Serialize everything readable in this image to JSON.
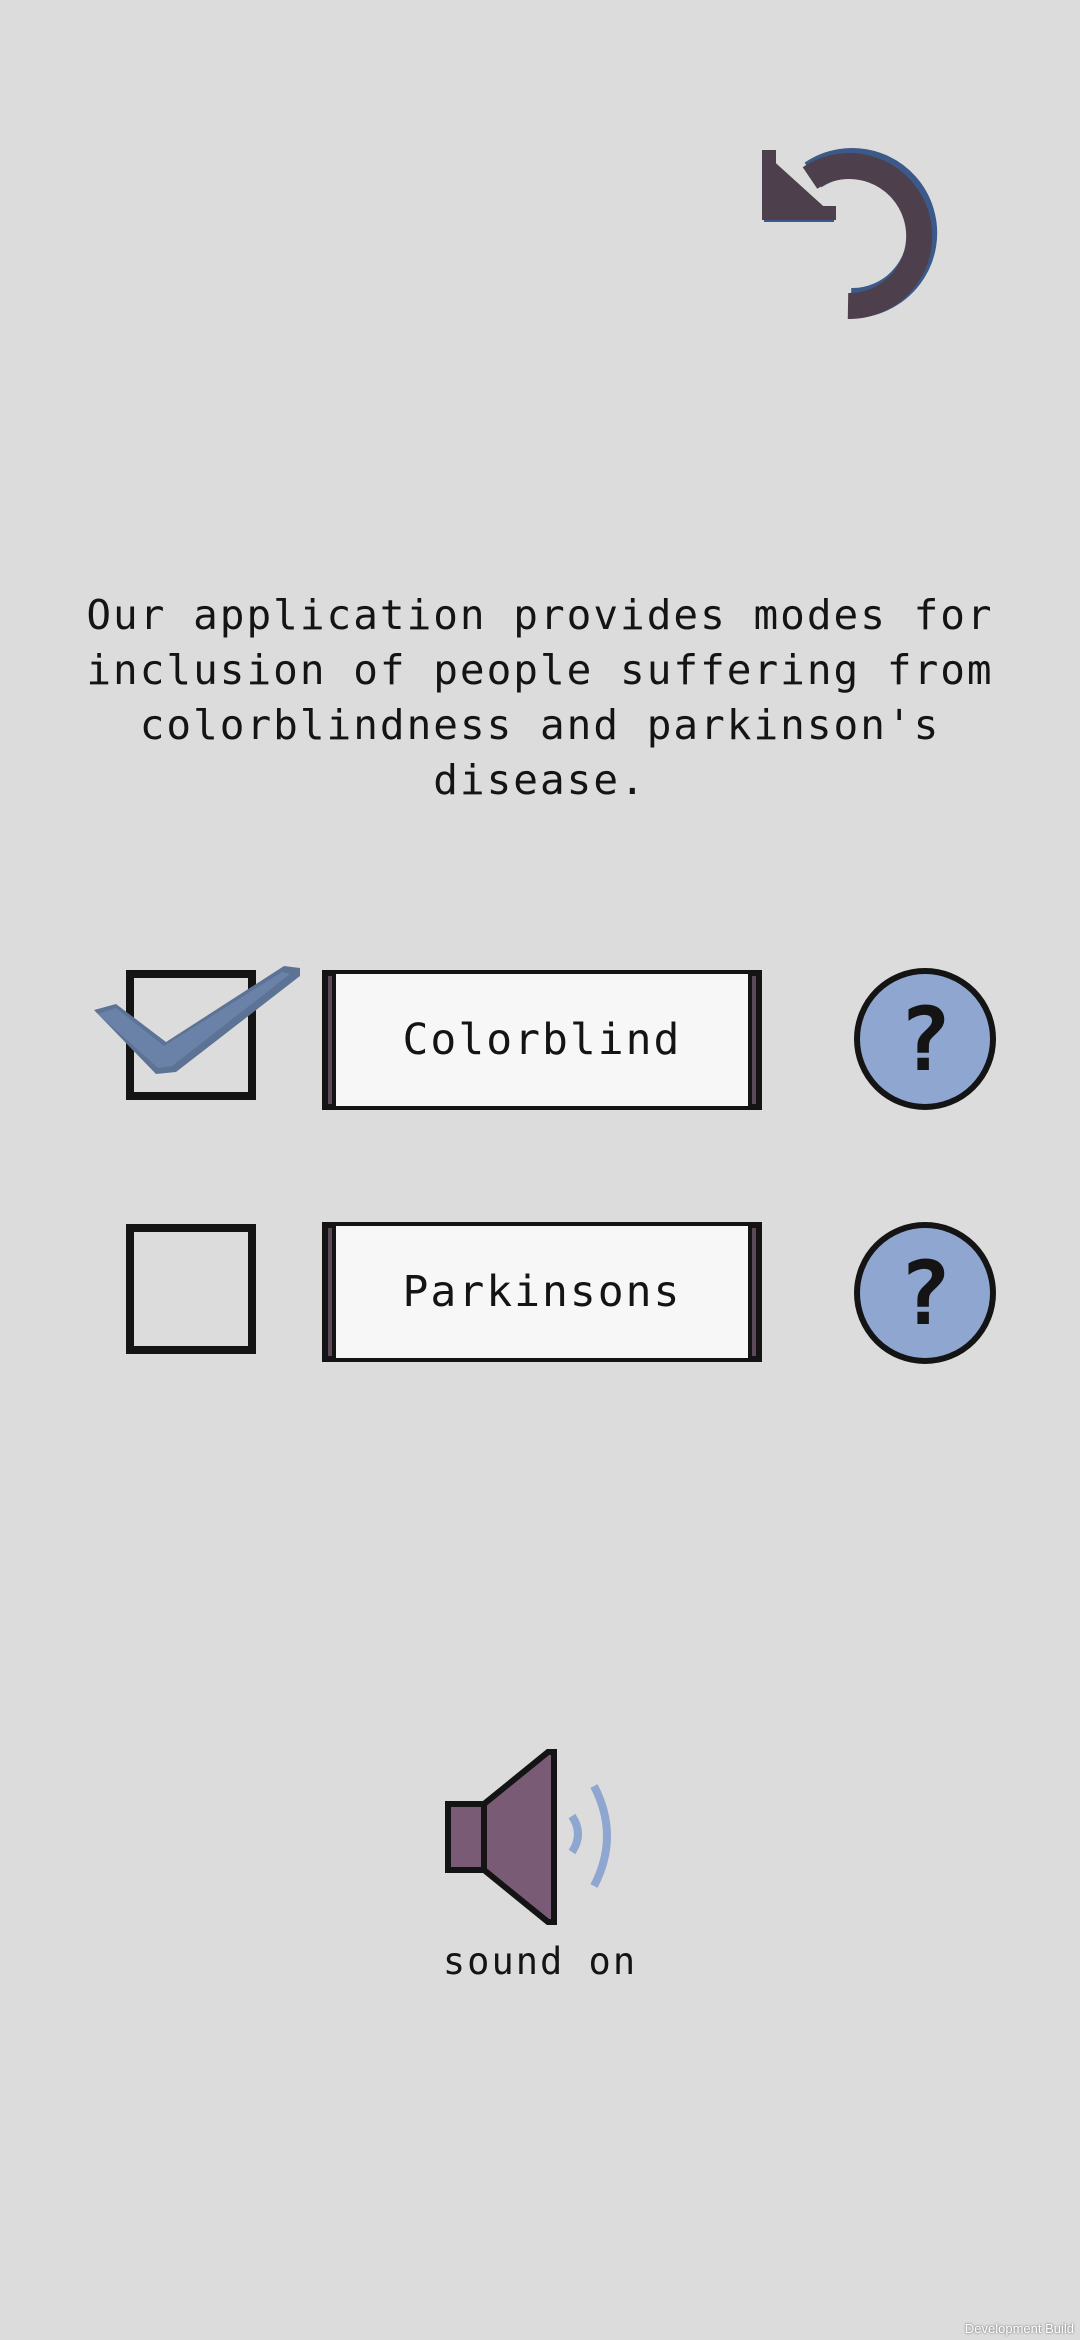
{
  "description": "Our application provides modes for\ninclusion of people suffering from\ncolorblindness and parkinson's\ndisease.",
  "modes": [
    {
      "label": "Colorblind",
      "checked": true
    },
    {
      "label": "Parkinsons",
      "checked": false
    }
  ],
  "help_symbol": "?",
  "sound": {
    "label": "sound on",
    "state": "on"
  },
  "footer": {
    "text": "Development Build"
  },
  "icons": {
    "back": "undo-arrow-icon",
    "check": "checkmark-icon",
    "help": "question-mark-icon",
    "speaker": "speaker-icon"
  },
  "colors": {
    "background": "#dcdcdc",
    "accent_blue": "#8fa6d0",
    "check_blue": "#5d7396",
    "icon_purple": "#4d3f4b",
    "speaker_purple": "#7a5b75",
    "outline": "#141414"
  }
}
